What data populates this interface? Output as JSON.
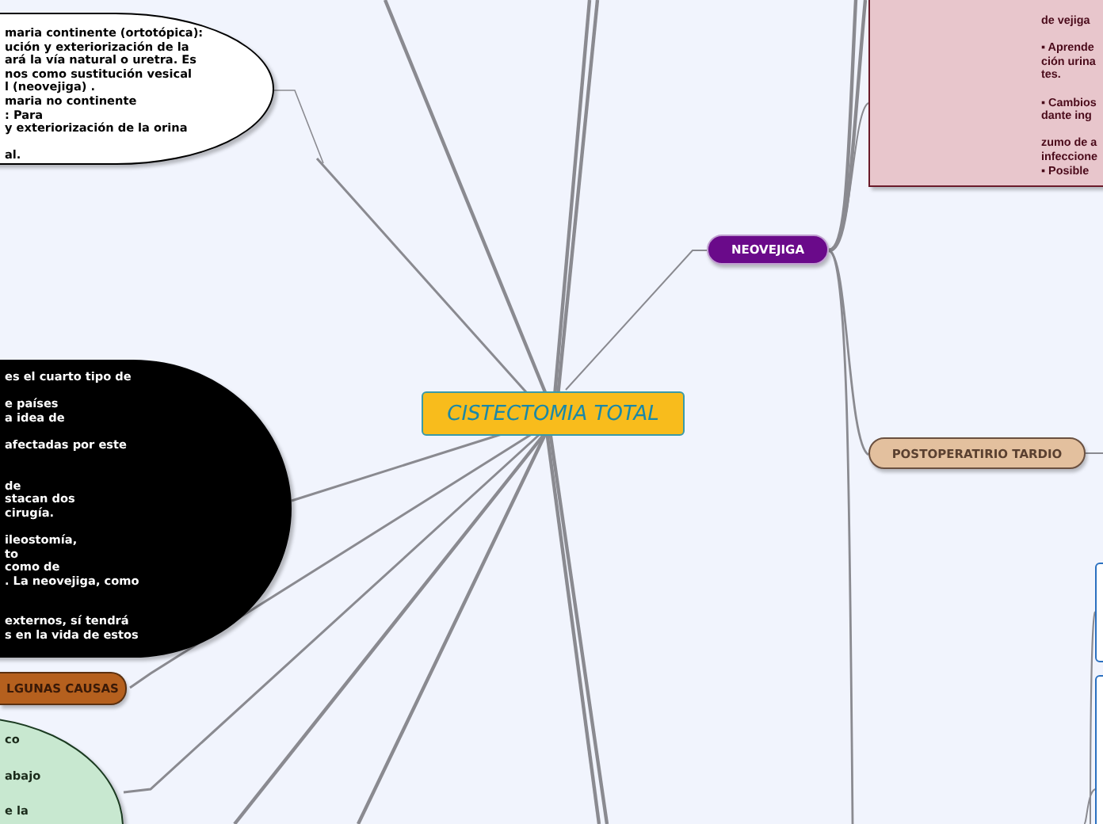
{
  "central_topic": {
    "label": "CISTECTOMIA TOTAL"
  },
  "nodes": [
    {
      "kind": "bubble",
      "color": "#ffffff",
      "paragraphs": [
        [
          "maria continente (ortotópica):",
          "ución y exteriorización de la",
          "ará la vía natural o uretra. Es",
          "nos como sustitución vesical",
          "l (neovejiga) .",
          "maria no continente",
          ": Para",
          "y exteriorización de la orina"
        ],
        [
          "al."
        ]
      ]
    },
    {
      "kind": "bubble",
      "color": "#000000",
      "paragraphs": [
        [
          "es el cuarto tipo de"
        ],
        [
          "e países",
          "a idea de"
        ],
        [
          "afectadas por este"
        ],
        [
          "de",
          "stacan dos",
          "cirugía."
        ],
        [
          "ileostomía,",
          "to",
          "como de",
          ". La neovejiga, como"
        ],
        [
          "externos, sí tendrá",
          "s en la vida de estos"
        ]
      ]
    },
    {
      "kind": "topic",
      "color": "#b5601e",
      "label": "LGUNAS CAUSAS"
    },
    {
      "kind": "bubble",
      "color": "#c8e8d0",
      "paragraphs": [
        [
          "co"
        ],
        [
          "abajo"
        ],
        [
          "e la"
        ]
      ]
    },
    {
      "kind": "topic",
      "color": "#6a0a8a",
      "label": "NEOVEJIGA"
    },
    {
      "kind": "bubble",
      "color": "#e8c6cc",
      "paragraphs": [
        [
          "de vejiga"
        ],
        [
          "▪ Aprende",
          "ción urina",
          "tes."
        ],
        [
          "▪ Cambios",
          "dante ing"
        ],
        [
          "zumo de a",
          "infeccione",
          "▪ Posible"
        ]
      ]
    },
    {
      "kind": "topic",
      "color": "#e3c09e",
      "label": "POSTOPERATIRIO TARDIO"
    },
    {
      "kind": "edgebox",
      "color": "#ffffff"
    },
    {
      "kind": "edgebox",
      "color": "#ffffff"
    }
  ]
}
